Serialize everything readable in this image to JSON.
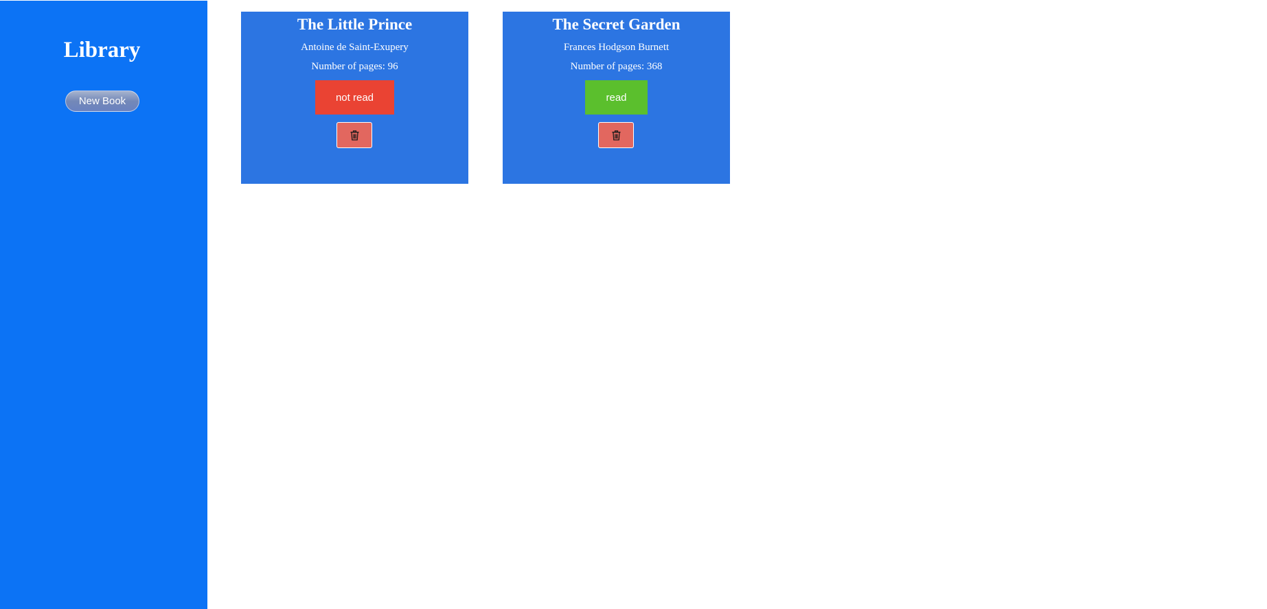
{
  "sidebar": {
    "title": "Library",
    "new_book_label": "New Book"
  },
  "books": [
    {
      "title": "The Little Prince",
      "author": "Antoine de Saint-Exupery",
      "pages": "Number of pages: 96",
      "status_label": "not read",
      "status_color": "#ea4333",
      "delete_icon": "trash-icon"
    },
    {
      "title": "The Secret Garden",
      "author": "Frances Hodgson Burnett",
      "pages": "Number of pages: 368",
      "status_label": "read",
      "status_color": "#5bbf2d",
      "delete_icon": "trash-icon"
    }
  ],
  "colors": {
    "sidebar_bg": "#0c73f5",
    "card_bg": "#2c75e2",
    "delete_bg": "#e2675f"
  }
}
